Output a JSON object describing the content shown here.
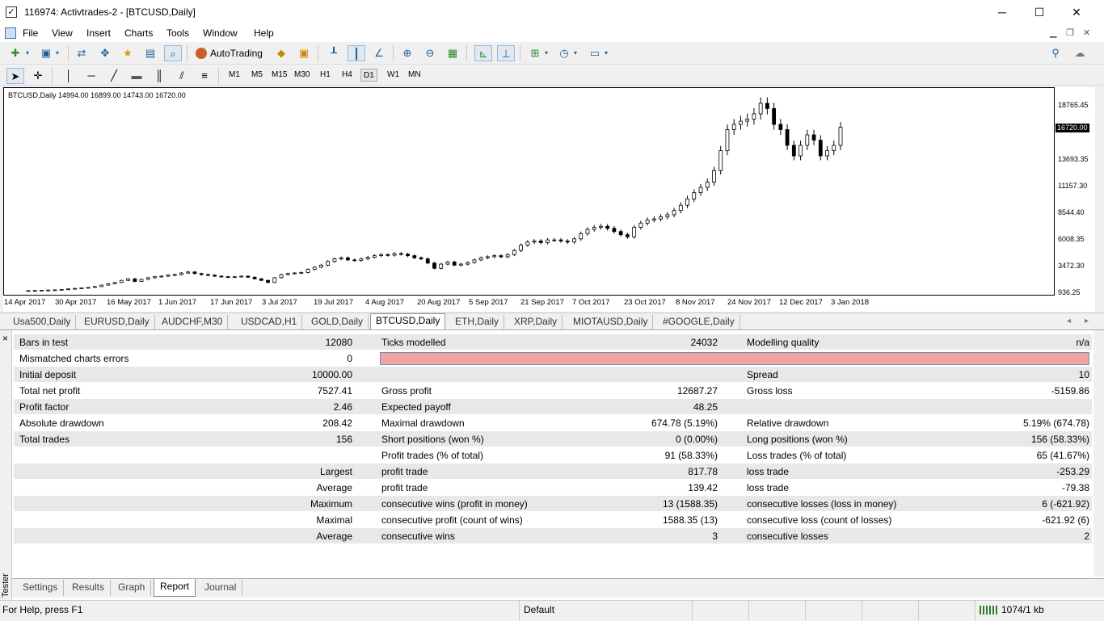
{
  "window": {
    "title": "116974: Activtrades-2 - [BTCUSD,Daily]",
    "minimize": "─",
    "maximize": "☐",
    "close": "✕"
  },
  "menu": {
    "items": [
      "File",
      "View",
      "Insert",
      "Charts",
      "Tools",
      "Window",
      "Help"
    ]
  },
  "toolbar": {
    "autotrading_label": "AutoTrading"
  },
  "timeframes": {
    "items": [
      "M1",
      "M5",
      "M15",
      "M30",
      "H1",
      "H4",
      "D1",
      "W1",
      "MN"
    ],
    "selected": "D1"
  },
  "chart": {
    "info": "BTCUSD,Daily  14994.00 16899.00 14743.00 16720.00",
    "symbol": "BTCUSD",
    "current_price": "16720.00",
    "price_levels": [
      "18765.45",
      "13693.35",
      "11157.30",
      "8544.40",
      "6008.35",
      "3472.30",
      "936.25"
    ],
    "date_labels": [
      "14 Apr 2017",
      "30 Apr 2017",
      "16 May 2017",
      "1 Jun 2017",
      "17 Jun 2017",
      "3 Jul 2017",
      "19 Jul 2017",
      "4 Aug 2017",
      "20 Aug 2017",
      "5 Sep 2017",
      "21 Sep 2017",
      "7 Oct 2017",
      "23 Oct 2017",
      "8 Nov 2017",
      "24 Nov 2017",
      "12 Dec 2017",
      "3 Jan 2018"
    ],
    "colors": {
      "up": "#ffffff",
      "down": "#000000",
      "line": "#000000"
    },
    "candles_close": [
      1180,
      1190,
      1210,
      1230,
      1250,
      1290,
      1340,
      1390,
      1430,
      1480,
      1560,
      1700,
      1830,
      1950,
      2150,
      2300,
      2050,
      2250,
      2400,
      2500,
      2550,
      2650,
      2700,
      2850,
      2950,
      2800,
      2700,
      2650,
      2550,
      2500,
      2450,
      2500,
      2550,
      2450,
      2300,
      2150,
      1950,
      2400,
      2700,
      2800,
      2850,
      2900,
      3200,
      3400,
      3600,
      3950,
      4200,
      4300,
      4100,
      4050,
      4200,
      4350,
      4500,
      4600,
      4550,
      4700,
      4650,
      4500,
      4300,
      4200,
      3800,
      3300,
      3700,
      3900,
      3600,
      3700,
      3850,
      4100,
      4300,
      4400,
      4500,
      4400,
      4600,
      5000,
      5500,
      5800,
      5900,
      5750,
      6000,
      6000,
      5900,
      5800,
      6100,
      6600,
      7000,
      7200,
      7300,
      7100,
      6800,
      6500,
      6300,
      7200,
      7600,
      7900,
      8000,
      8200,
      8400,
      8800,
      9300,
      9900,
      10500,
      11000,
      11500,
      12600,
      14500,
      16500,
      17000,
      17300,
      17500,
      18000,
      19000,
      18500,
      17000,
      16500,
      15000,
      14000,
      15000,
      16000,
      15500,
      14000,
      14500,
      15000,
      16720
    ]
  },
  "chart_tabs": {
    "items": [
      "Usa500,Daily",
      "EURUSD,Daily",
      "AUDCHF,M30",
      "USDCAD,H1",
      "GOLD,Daily",
      "BTCUSD,Daily",
      "ETH,Daily",
      "XRP,Daily",
      "MIOTAUSD,Daily",
      "#GOOGLE,Daily"
    ],
    "active": "BTCUSD,Daily",
    "prev": "◂",
    "next": "▸"
  },
  "report": {
    "rows": [
      {
        "c1": "Bars in test",
        "v1": "12080",
        "c2": "Ticks modelled",
        "v2": "24032",
        "c3": "Modelling quality",
        "v3": "n/a"
      },
      {
        "c1": "Mismatched charts errors",
        "v1": "0",
        "c2": "",
        "v2": "",
        "c3": "",
        "v3": "",
        "bar": true
      },
      {
        "c1": "Initial deposit",
        "v1": "10000.00",
        "c2": "",
        "v2": "",
        "c3": "Spread",
        "v3": "10"
      },
      {
        "c1": "Total net profit",
        "v1": "7527.41",
        "c2": "Gross profit",
        "v2": "12687.27",
        "c3": "Gross loss",
        "v3": "-5159.86"
      },
      {
        "c1": "Profit factor",
        "v1": "2.46",
        "c2": "Expected payoff",
        "v2": "48.25",
        "c3": "",
        "v3": ""
      },
      {
        "c1": "Absolute drawdown",
        "v1": "208.42",
        "c2": "Maximal drawdown",
        "v2": "674.78 (5.19%)",
        "c3": "Relative drawdown",
        "v3": "5.19% (674.78)"
      },
      {
        "c1": "Total trades",
        "v1": "156",
        "c2": "Short positions (won %)",
        "v2": "0 (0.00%)",
        "c3": "Long positions (won %)",
        "v3": "156 (58.33%)"
      },
      {
        "c1": "",
        "v1": "",
        "c2": "Profit trades (% of total)",
        "v2": "91 (58.33%)",
        "c3": "Loss trades (% of total)",
        "v3": "65 (41.67%)"
      },
      {
        "c1": "",
        "v1": "Largest",
        "c2": "profit trade",
        "v2": "817.78",
        "c3": "loss trade",
        "v3": "-253.29"
      },
      {
        "c1": "",
        "v1": "Average",
        "c2": "profit trade",
        "v2": "139.42",
        "c3": "loss trade",
        "v3": "-79.38"
      },
      {
        "c1": "",
        "v1": "Maximum",
        "c2": "consecutive wins (profit in money)",
        "v2": "13 (1588.35)",
        "c3": "consecutive losses (loss in money)",
        "v3": "6 (-621.92)"
      },
      {
        "c1": "",
        "v1": "Maximal",
        "c2": "consecutive profit (count of wins)",
        "v2": "1588.35 (13)",
        "c3": "consecutive loss (count of losses)",
        "v3": "-621.92 (6)"
      },
      {
        "c1": "",
        "v1": "Average",
        "c2": "consecutive wins",
        "v2": "3",
        "c3": "consecutive losses",
        "v3": "2"
      }
    ]
  },
  "tester": {
    "side_label": "Tester",
    "close": "×",
    "tabs": [
      "Settings",
      "Results",
      "Graph",
      "Report",
      "Journal"
    ],
    "active_tab": "Report"
  },
  "status": {
    "help": "For Help, press F1",
    "profile": "Default",
    "traffic": "1074/1 kb"
  }
}
